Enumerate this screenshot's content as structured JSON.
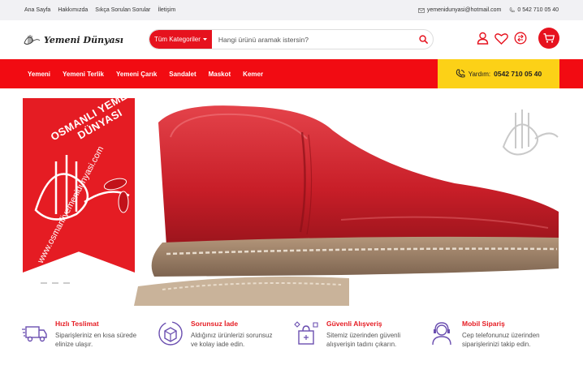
{
  "topbar": {
    "links": [
      "Ana Sayfa",
      "Hakkımızda",
      "Sıkça Sorulan Sorular",
      "İletişim"
    ],
    "email": "yemenidunyasi@hotmail.com",
    "phone": "0 542 710 05 40"
  },
  "header": {
    "logo_text": "Yemeni Dünyası",
    "search_category": "Tüm Kategoriler",
    "search_placeholder": "Hangi ürünü aramak istersin?"
  },
  "nav": {
    "items": [
      "Yemeni",
      "Yemeni Terlik",
      "Yemeni Çarık",
      "Sandalet",
      "Maskot",
      "Kemer"
    ],
    "help_label": "Yardım:",
    "help_phone": "0542 710 05 40"
  },
  "hero": {
    "banner_title": "OSMANLI YEMENİ DÜNYASI",
    "banner_url": "www.osmanliyemenidunyasi.com",
    "slide_count": 3
  },
  "features": [
    {
      "title": "Hızlı Teslimat",
      "desc1": "Siparişleriniz en kısa sürede",
      "desc2": "elinize ulaşır.",
      "icon": "delivery-truck-icon"
    },
    {
      "title": "Sorunsuz İade",
      "desc1": "Aldığınız ürünlerizi sorunsuz",
      "desc2": "ve kolay iade edin.",
      "icon": "return-box-icon"
    },
    {
      "title": "Güvenli Alışveriş",
      "desc1": "Sitemiz üzerinden güvenli",
      "desc2": "alışverişin tadını çıkarın.",
      "icon": "secure-shopping-icon"
    },
    {
      "title": "Mobil Sipariş",
      "desc1": "Cep telefonunuz üzerinden",
      "desc2": "siparişlerinizi takip edin.",
      "icon": "mobile-support-icon"
    }
  ],
  "colors": {
    "brand_red": "#f20b12",
    "help_yellow": "#fcd117",
    "purple_icon": "#6b4fb0"
  }
}
